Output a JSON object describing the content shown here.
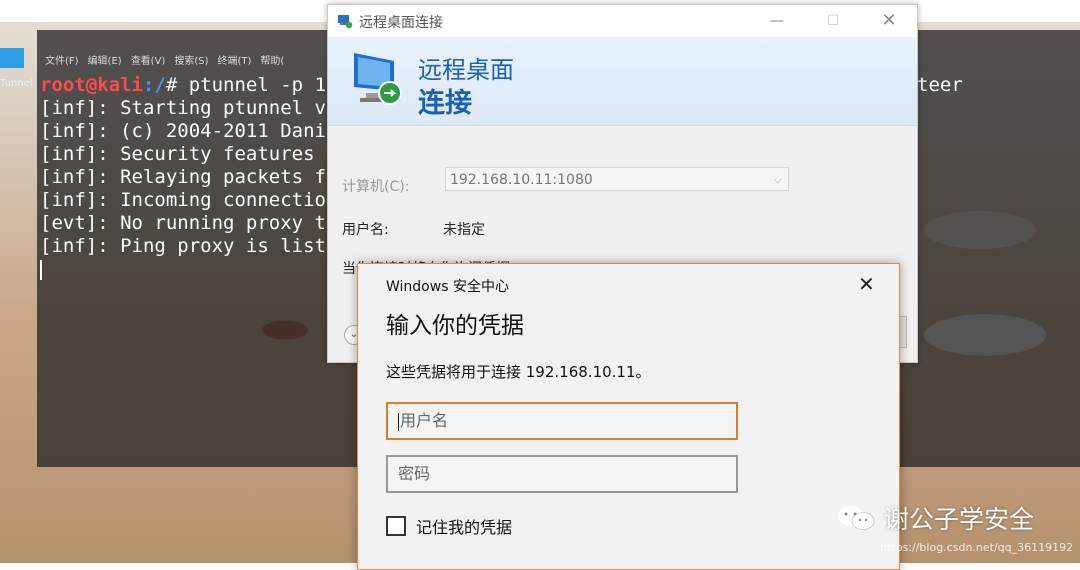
{
  "desktop": {
    "icon_label": "Tunnel"
  },
  "terminal": {
    "menu": [
      "文件(F)",
      "编辑(E)",
      "查看(V)",
      "搜索(S)",
      "终端(T)",
      "帮助("
    ],
    "prompt_user": "root@kali",
    "prompt_path": ":/",
    "prompt_symbol": "# ",
    "command": "ptunnel -p 19",
    "command_tail": "teer",
    "lines": [
      "[inf]: Starting ptunnel v",
      "[inf]: (c) 2004-2011 Danie",
      "[inf]: Security features b",
      "[inf]: Relaying packets fr",
      "[inf]: Incoming connection",
      "[evt]: No running proxy th",
      "[inf]: Ping proxy is liste"
    ]
  },
  "rdp": {
    "window_title": "远程桌面连接",
    "heading_line1": "远程桌面",
    "heading_line2": "连接",
    "computer_label": "计算机(C):",
    "computer_value": "192.168.10.11:1080",
    "username_label": "用户名:",
    "username_value": "未指定",
    "prompt_note": "当你连接时将向你询问凭据。",
    "minimize": "—",
    "maximize": "☐",
    "close": "✕"
  },
  "security": {
    "title": "Windows 安全中心",
    "heading": "输入你的凭据",
    "description": "这些凭据将用于连接 192.168.10.11。",
    "username_placeholder": "用户名",
    "password_placeholder": "密码",
    "remember_label": "记住我的凭据",
    "close": "✕"
  },
  "watermark": {
    "name": "谢公子学安全",
    "url": "https://blog.csdn.net/qq_36119192"
  },
  "colors": {
    "rdp_blue": "#1b5fb8",
    "focus_orange": "#e07a2c",
    "kali_red": "#ff4b4b"
  }
}
